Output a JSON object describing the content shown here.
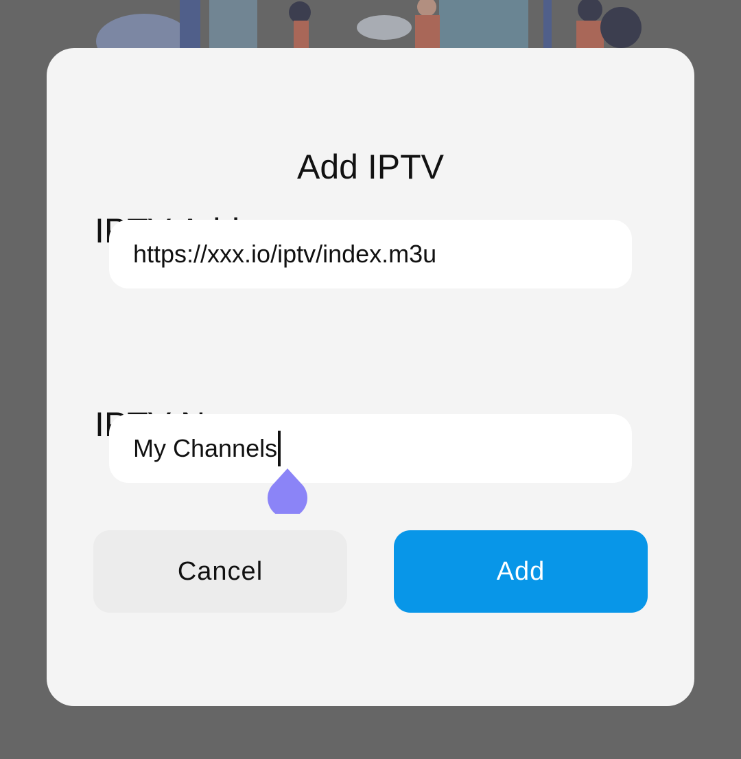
{
  "dialog": {
    "title": "Add IPTV",
    "address": {
      "label": "IPTV Address",
      "value": "https://xxx.io/iptv/index.m3u"
    },
    "name": {
      "label": "IPTV Name",
      "value": "My Channels"
    },
    "buttons": {
      "cancel": "Cancel",
      "add": "Add"
    }
  },
  "colors": {
    "backdrop": "#666666",
    "dialog_bg": "#f4f4f4",
    "field_bg": "#ffffff",
    "cancel_bg": "#ececec",
    "add_bg": "#0896e8",
    "text_handle": "#8b84f7"
  }
}
